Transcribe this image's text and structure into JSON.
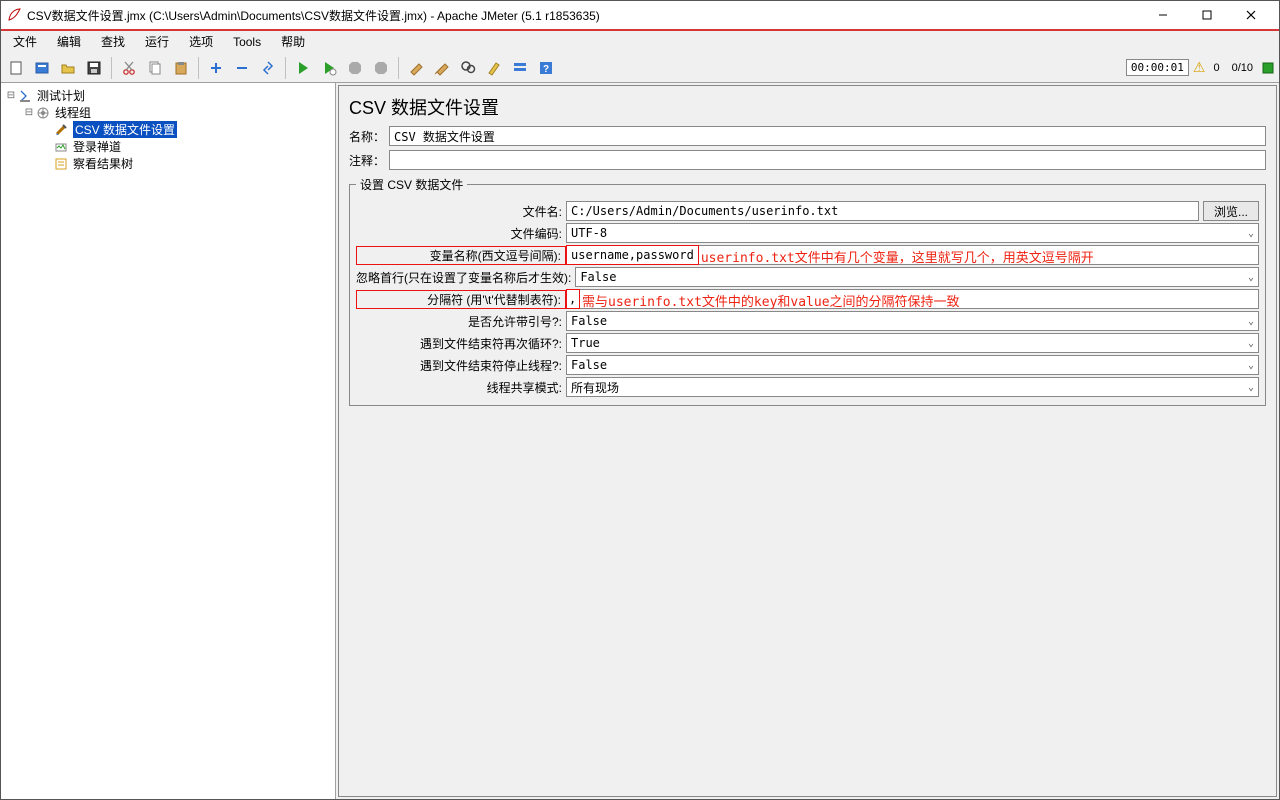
{
  "window": {
    "title": "CSV数据文件设置.jmx (C:\\Users\\Admin\\Documents\\CSV数据文件设置.jmx) - Apache JMeter (5.1 r1853635)"
  },
  "menu": {
    "items": [
      "文件",
      "编辑",
      "查找",
      "运行",
      "选项",
      "Tools",
      "帮助"
    ]
  },
  "status": {
    "timer": "00:00:01",
    "count1": "0",
    "count2": "0/10"
  },
  "tree": {
    "root": "测试计划",
    "thread_group": "线程组",
    "csv_config": "CSV 数据文件设置",
    "login": "登录禅道",
    "view_results": "察看结果树"
  },
  "panel": {
    "title": "CSV 数据文件设置",
    "name_label": "名称：",
    "name_value": "CSV 数据文件设置",
    "comment_label": "注释：",
    "comment_value": "",
    "fieldset_legend": "设置 CSV 数据文件",
    "filename_label": "文件名:",
    "filename_value": "C:/Users/Admin/Documents/userinfo.txt",
    "browse_btn": "浏览...",
    "encoding_label": "文件编码:",
    "encoding_value": "UTF-8",
    "varnames_label": "变量名称(西文逗号间隔):",
    "varnames_value": "username,password",
    "ignore_first_label": "忽略首行(只在设置了变量名称后才生效):",
    "ignore_first_value": "False",
    "delimiter_label": "分隔符 (用'\\t'代替制表符):",
    "delimiter_value": ",",
    "quoted_label": "是否允许带引号?:",
    "quoted_value": "False",
    "recycle_label": "遇到文件结束符再次循环?:",
    "recycle_value": "True",
    "stop_label": "遇到文件结束符停止线程?:",
    "stop_value": "False",
    "sharing_label": "线程共享模式:",
    "sharing_value": "所有现场",
    "annotation_varnames": "userinfo.txt文件中有几个变量，这里就写几个，用英文逗号隔开",
    "annotation_delimiter": "需与userinfo.txt文件中的key和value之间的分隔符保持一致"
  }
}
